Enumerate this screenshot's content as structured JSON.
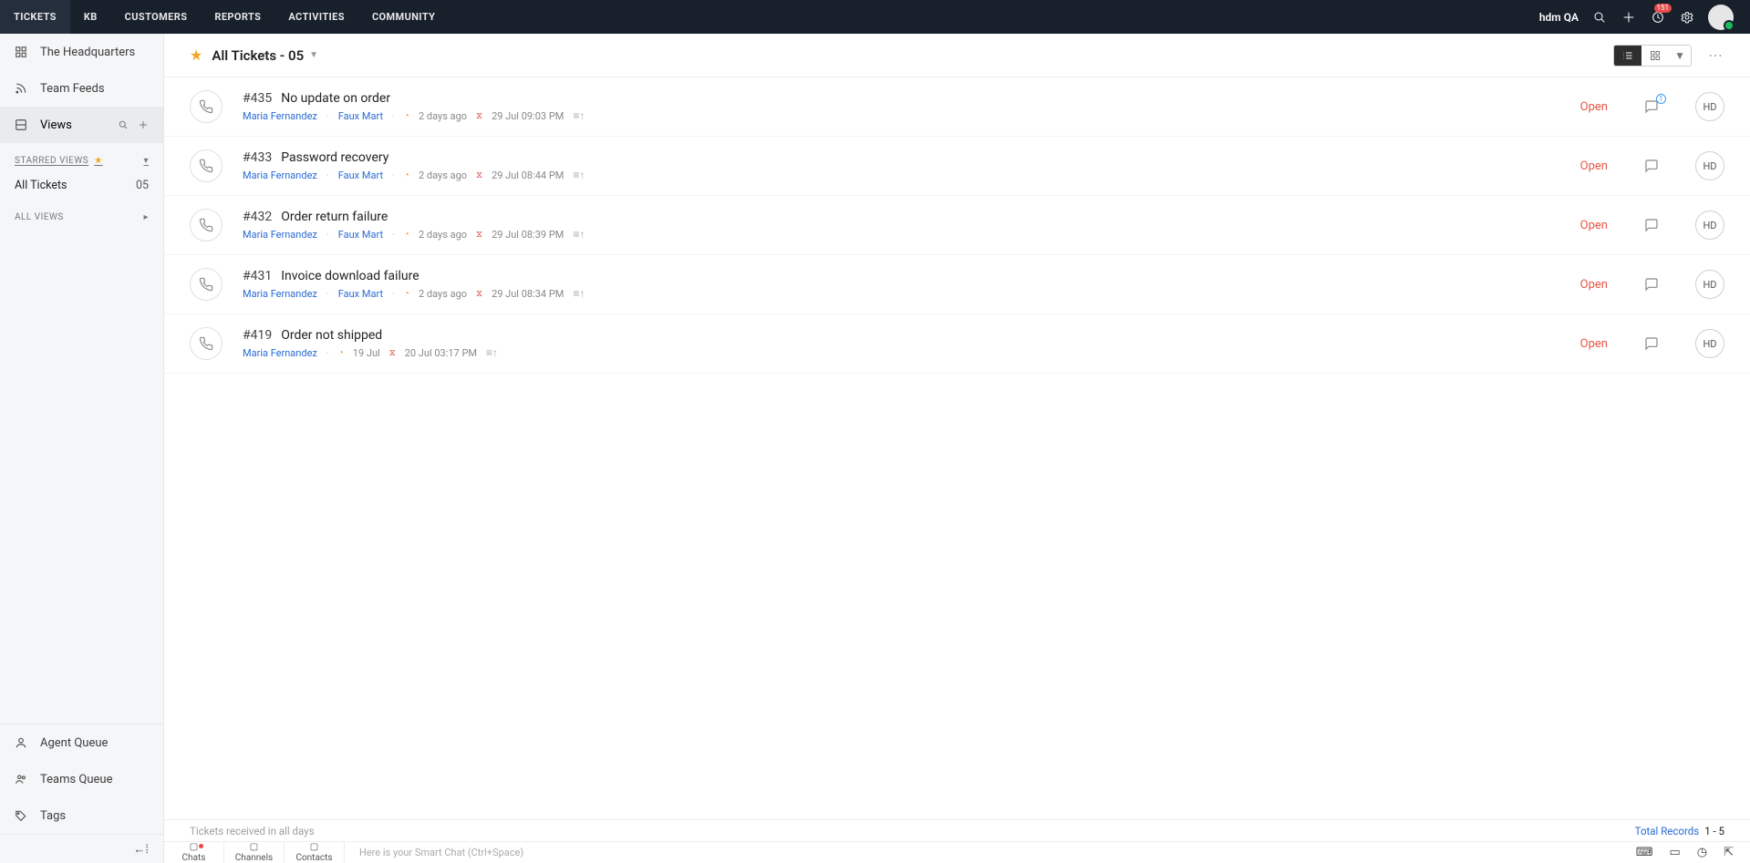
{
  "topnav": {
    "items": [
      "TICKETS",
      "KB",
      "CUSTOMERS",
      "REPORTS",
      "ACTIVITIES",
      "COMMUNITY"
    ],
    "user": "hdm QA",
    "notif_badge": "151"
  },
  "sidebar": {
    "hq": "The Headquarters",
    "feeds": "Team Feeds",
    "views": "Views",
    "starred_hdr": "STARRED VIEWS",
    "starred": [
      {
        "label": "All Tickets",
        "count": "05"
      }
    ],
    "all_views_hdr": "ALL VIEWS",
    "bottom": {
      "agent_q": "Agent Queue",
      "teams_q": "Teams Queue",
      "tags": "Tags"
    }
  },
  "page": {
    "title": "All Tickets - 05"
  },
  "tickets": [
    {
      "id": "#435",
      "subject": "No update on order",
      "person": "Maria Fernandez",
      "company": "Faux Mart",
      "ago": "2 days ago",
      "due": "29 Jul 09:03 PM",
      "status": "Open",
      "hd": "HD",
      "has_chat_badge": true
    },
    {
      "id": "#433",
      "subject": "Password recovery",
      "person": "Maria Fernandez",
      "company": "Faux Mart",
      "ago": "2 days ago",
      "due": "29 Jul 08:44 PM",
      "status": "Open",
      "hd": "HD",
      "has_chat_badge": false
    },
    {
      "id": "#432",
      "subject": "Order return failure",
      "person": "Maria Fernandez",
      "company": "Faux Mart",
      "ago": "2 days ago",
      "due": "29 Jul 08:39 PM",
      "status": "Open",
      "hd": "HD",
      "has_chat_badge": false
    },
    {
      "id": "#431",
      "subject": "Invoice download failure",
      "person": "Maria Fernandez",
      "company": "Faux Mart",
      "ago": "2 days ago",
      "due": "29 Jul 08:34 PM",
      "status": "Open",
      "hd": "HD",
      "has_chat_badge": false
    },
    {
      "id": "#419",
      "subject": "Order not shipped",
      "person": "Maria Fernandez",
      "company": null,
      "ago": "19 Jul",
      "due": "20 Jul 03:17 PM",
      "status": "Open",
      "hd": "HD",
      "has_chat_badge": false
    }
  ],
  "statusbar": {
    "left": "Tickets received in all days",
    "total_label": "Total Records",
    "range": "1 - 5"
  },
  "chatbar": {
    "tabs": [
      "Chats",
      "Channels",
      "Contacts"
    ],
    "smart": "Here is your Smart Chat (Ctrl+Space)"
  }
}
